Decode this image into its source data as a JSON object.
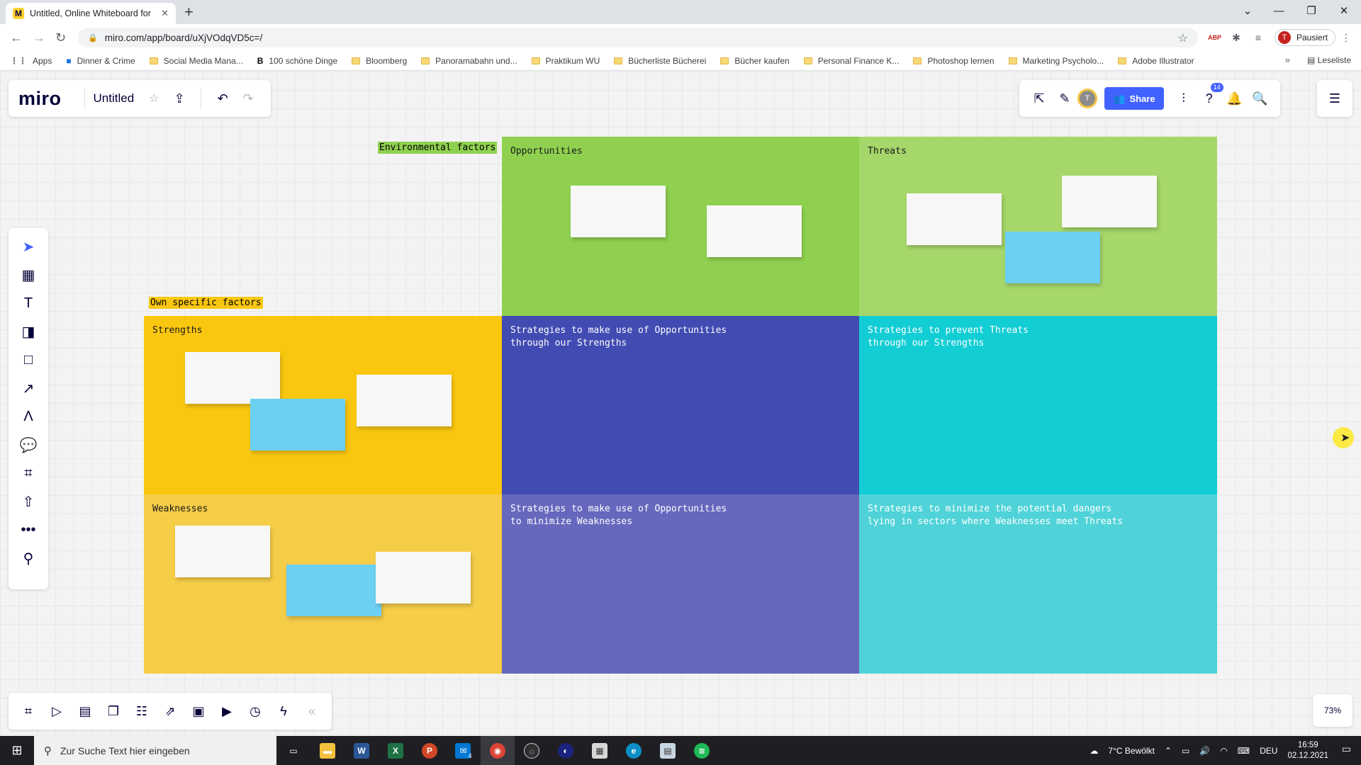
{
  "browser": {
    "tab_title": "Untitled, Online Whiteboard for",
    "url": "miro.com/app/board/uXjVOdqVD5c=/",
    "profile_label": "Pausiert",
    "profile_initial": "T",
    "bookmarks": [
      {
        "label": "Apps",
        "kind": "apps"
      },
      {
        "label": "Dinner & Crime",
        "kind": "site"
      },
      {
        "label": "Social Media Mana...",
        "kind": "folder"
      },
      {
        "label": "100 schöne Dinge",
        "kind": "site"
      },
      {
        "label": "Bloomberg",
        "kind": "folder"
      },
      {
        "label": "Panoramabahn und...",
        "kind": "folder"
      },
      {
        "label": "Praktikum WU",
        "kind": "folder"
      },
      {
        "label": "Bücherliste Bücherei",
        "kind": "folder"
      },
      {
        "label": "Bücher kaufen",
        "kind": "folder"
      },
      {
        "label": "Personal Finance K...",
        "kind": "folder"
      },
      {
        "label": "Photoshop lernen",
        "kind": "folder"
      },
      {
        "label": "Marketing Psycholo...",
        "kind": "folder"
      },
      {
        "label": "Adobe Illustrator",
        "kind": "folder"
      }
    ],
    "reading_list": "Leseliste"
  },
  "miro": {
    "logo": "miro",
    "board_title": "Untitled",
    "share_label": "Share",
    "help_badge": "14",
    "avatar_initial": "T",
    "zoom": "73%"
  },
  "board": {
    "environmental_label": "Environmental factors",
    "own_label": "Own specific factors",
    "opportunities": "Opportunities",
    "threats": "Threats",
    "strengths": "Strengths",
    "weaknesses": "Weaknesses",
    "so": "Strategies to make use of Opportunities\nthrough our Strengths",
    "st": "Strategies to prevent Threats\nthrough our Strengths",
    "wo": "Strategies to make use of Opportunities\nto minimize Weaknesses",
    "wt": "Strategies to minimize the potential dangers\nlying in sectors where Weaknesses meet Threats"
  },
  "colors": {
    "opportunities": "#8fd14f",
    "threats": "#a6d76a",
    "strengths": "#fac710",
    "weaknesses": "#f5cd47",
    "so": "#414bb2",
    "st": "#12cdd4",
    "wo": "#6568bd",
    "wt": "#4fd3d8",
    "env_tag": "#8fd14f",
    "own_tag": "#fac710"
  },
  "taskbar": {
    "search_placeholder": "Zur Suche Text hier eingeben",
    "weather": "7°C  Bewölkt",
    "lang": "DEU",
    "time": "16:59",
    "date": "02.12.2021",
    "mail_badge": "4"
  }
}
